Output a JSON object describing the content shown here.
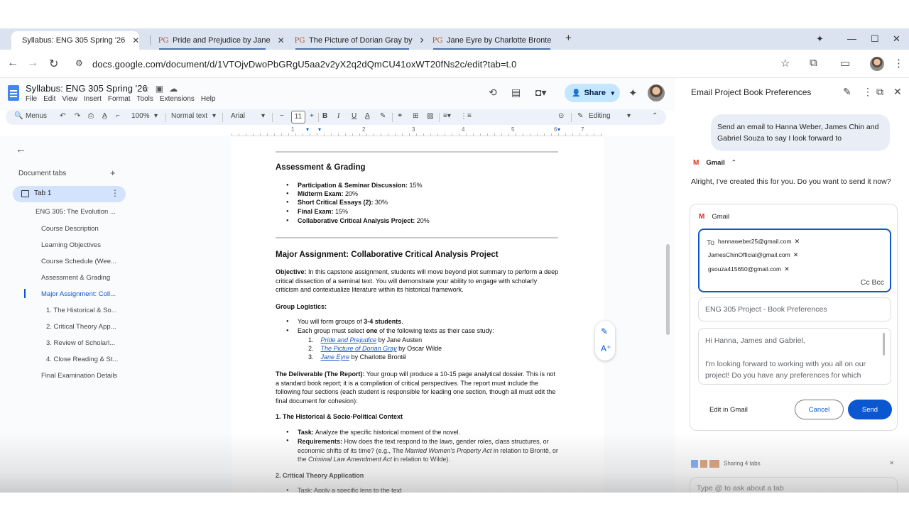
{
  "browser": {
    "tabs": [
      {
        "title": "Syllabus: ENG 305 Spring '26",
        "favicon": "docs-icon",
        "active": true
      },
      {
        "title": "Pride and Prejudice by Jane",
        "favicon": "PG"
      },
      {
        "title": "The Picture of Dorian Gray by",
        "favicon": "PG"
      },
      {
        "title": "Jane Eyre by Charlotte Bronte",
        "favicon": "PG"
      }
    ],
    "new_tab": "+",
    "url": "docs.google.com/document/d/1VTOjvDwoPbGRgU5aa2v2yX2q2dQmCU41oxWT20fNs2c/edit?tab=t.0"
  },
  "docs": {
    "title": "Syllabus: ENG 305 Spring '26",
    "menu": [
      "File",
      "Edit",
      "View",
      "Insert",
      "Format",
      "Tools",
      "Extensions",
      "Help"
    ],
    "share_label": "Share",
    "toolbar": {
      "menus": "Menus",
      "zoom": "100%",
      "style": "Normal text",
      "font": "Arial",
      "font_size": "11",
      "mode": "Editing"
    },
    "ruler_numbers": [
      "1",
      "2",
      "3",
      "4",
      "5",
      "6",
      "7"
    ]
  },
  "left_panel": {
    "header": "Document tabs",
    "tab_name": "Tab 1",
    "outline": [
      "ENG 305: The Evolution ...",
      "Course Description",
      "Learning Objectives",
      "Course Schedule (Wee...",
      "Assessment & Grading",
      "Major Assignment: Coll...",
      "1. The Historical & So...",
      "2. Critical Theory App...",
      "3. Review of Scholarl...",
      "4. Close Reading & St...",
      "Final Examination Details"
    ]
  },
  "doc": {
    "assessment_heading": "Assessment & Grading",
    "grading": [
      {
        "label": "Participation & Seminar Discussion:",
        "value": " 15%"
      },
      {
        "label": "Midterm Exam:",
        "value": " 20%"
      },
      {
        "label": "Short Critical Essays (2):",
        "value": " 30%"
      },
      {
        "label": "Final Exam:",
        "value": " 15%"
      },
      {
        "label": "Collaborative Critical Analysis Project:",
        "value": " 20%"
      }
    ],
    "major_heading": "Major Assignment: Collaborative Critical Analysis Project",
    "objective_label": "Objective:",
    "objective_text": " In this capstone assignment, students will move beyond plot summary to perform a deep critical dissection of a seminal text. You will demonstrate your ability to engage with scholarly criticism and contextualize literature within its historical framework.",
    "group_heading": "Group Logistics:",
    "group_b1_pre": "You will form groups of ",
    "group_b1_bold": "3-4 students",
    "group_b1_post": ".",
    "group_b2_pre": "Each group must select ",
    "group_b2_bold": "one",
    "group_b2_post": " of the following texts as their case study:",
    "books": [
      {
        "num": "1.",
        "title": "Pride and Prejudice",
        "author": " by Jane Austen"
      },
      {
        "num": "2.",
        "title": "The Picture of Dorian Gray",
        "author": " by Oscar Wilde"
      },
      {
        "num": "3.",
        "title": "Jane Eyre",
        "author": "  by Charlotte Brontë"
      }
    ],
    "deliverable_label": "The Deliverable (The Report):",
    "deliverable_text": " Your group will produce a 10-15 page analytical dossier. This is not a standard book report; it is a compilation of critical perspectives. The report must include the following four sections (each student is responsible for leading one section, though all must edit the final document for cohesion):",
    "section1_heading": "1. The Historical & Socio-Political Context",
    "task_label": "Task:",
    "task_text": " Analyze the specific historical moment of the novel.",
    "req_label": "Requirements:",
    "req_text_1": " How does the text respond to the laws, gender roles, class structures, or economic shifts of its time? (e.g., The ",
    "req_italic_1": "Married Women's Property Act",
    "req_text_2": " in relation to Brontë, or the ",
    "req_italic_2": "Criminal Law Amendment Act",
    "req_text_3": " in relation to Wilde).",
    "section2_heading": "2. Critical Theory Application",
    "section2_cut": "Task: Apply a specific lens to the text"
  },
  "gemini": {
    "title": "Email Project Book Preferences",
    "user_message": "Send an email to Hanna Weber, James Chin and Gabriel Souza to say I look forward to",
    "tool_chip": "Gmail",
    "reply": "Alright, I've created this for you. Do you want to send it now?",
    "card_label": "Gmail",
    "to_label": "To",
    "recipients": [
      "hannaweber25@gmail.com",
      "JamesChinOfficial@gmail.com",
      "gsouza415650@gmail.com"
    ],
    "cc_bcc": "Cc Bcc",
    "subject": "ENG 305 Project - Book Preferences",
    "body_line1": "Hi Hanna, James and Gabriel,",
    "body_line2": "I'm looking forward to working with you all on our project! Do you have any preferences for which",
    "edit_in_gmail": "Edit in Gmail",
    "cancel": "Cancel",
    "send": "Send",
    "sharing": "Sharing 4 tabs",
    "prompt_placeholder": "Type @ to ask about a tab"
  }
}
